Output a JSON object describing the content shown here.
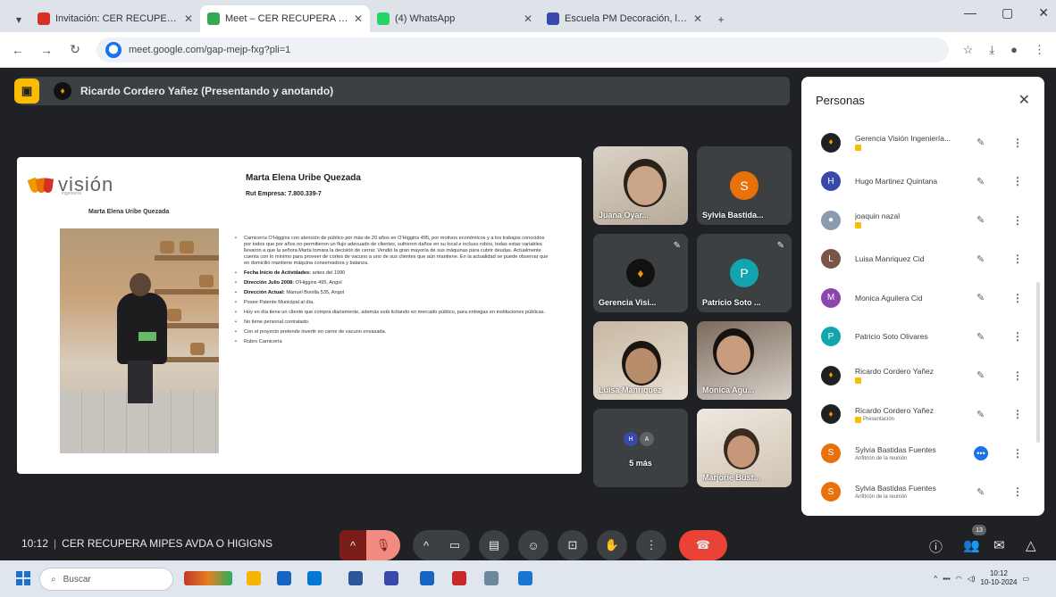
{
  "browser": {
    "tabs": [
      {
        "label": "Invitación: CER RECUPERA MIP...",
        "color": "#d93025",
        "active": false
      },
      {
        "label": "Meet – CER RECUPERA MIP...",
        "color": "#34a853",
        "active": true
      },
      {
        "label": "(4) WhatsApp",
        "color": "#25d366",
        "active": false
      },
      {
        "label": "Escuela PM Decoración, la vent...",
        "color": "#3949ab",
        "active": false
      }
    ],
    "url": "meet.google.com/gap-mejp-fxg?pli=1"
  },
  "meet": {
    "presenter_label": "Ricardo Cordero Yañez (Presentando y anotando)",
    "slide": {
      "logo_text": "visión",
      "logo_sub": "ingeniería",
      "left_caption": "Marta Elena Uribe Quezada",
      "title": "Marta Elena Uribe Quezada",
      "rut": "Rut Empresa: 7.800.339-7",
      "bullets": [
        {
          "bold": "",
          "text": "Carnicería O'Higgins con atención de público por más de 20 años en O'Higgins 495, por motivos económicos y a los trabajos conocidos por todos que por años no permitieron un flujo adecuado de clientes, sufrieron daños en su local e incluso robos, todas estas variables llevaron a que la señora Marta tomara la decisión de cerrar. Vendió la gran mayoría de sus máquinas para cubrir deudas. Actualmente cuenta con lo mínimo para proveer de cortes de vacuno a uno de sus clientes que aún mantiene. En la actualidad se puede observar que en domicilio mantiene máquina conservadora y balanza."
        },
        {
          "bold": "Fecha Inicio de Actividades:",
          "text": " antes del 1990"
        },
        {
          "bold": "Dirección Julio 2008:",
          "text": " O'Higgins 495, Angol"
        },
        {
          "bold": "Dirección Actual:",
          "text": " Manuel Bonilla 535, Angol"
        },
        {
          "bold": "",
          "text": "Posee Patente Municipal al día."
        },
        {
          "bold": "",
          "text": "Hoy en día tiene un cliente que compra diariamente, además está licitando en mercado público, para entregas en instituciones públicas."
        },
        {
          "bold": "",
          "text": "No tiene personal contratado."
        },
        {
          "bold": "",
          "text": "Con el proyecto pretende invertir en carne de vacuno envasada."
        },
        {
          "bold": "",
          "text": "Rubro Carnicería"
        }
      ]
    },
    "tiles": [
      {
        "name": "Juana Oyar...",
        "kind": "video",
        "muted": false
      },
      {
        "name": "Sylvia Bastida...",
        "kind": "avatar",
        "initial": "S",
        "color": "#e8710a",
        "muted": false
      },
      {
        "name": "Gerencia Visi...",
        "kind": "logo",
        "muted": true
      },
      {
        "name": "Patricio Soto ...",
        "kind": "avatar",
        "initial": "P",
        "color": "#12a4af",
        "muted": true
      },
      {
        "name": "Luisa Manriquez",
        "kind": "video",
        "muted": false
      },
      {
        "name": "Monica Agu...",
        "kind": "video",
        "muted": false
      },
      {
        "name": "5 más",
        "kind": "more",
        "muted": false
      },
      {
        "name": "Marjorie Bust...",
        "kind": "video",
        "muted": false
      }
    ],
    "people_panel": {
      "title": "Personas",
      "participants": [
        {
          "name": "Gerencia Visión Ingeniería...",
          "sub": "",
          "badge": true,
          "initial": "",
          "color": "#202124",
          "speaking": false
        },
        {
          "name": "Hugo Martinez Quintana",
          "sub": "",
          "badge": false,
          "initial": "H",
          "color": "#3949ab",
          "speaking": false
        },
        {
          "name": "joaquin nazal",
          "sub": "",
          "badge": true,
          "initial": "",
          "color": "#8a9bb0",
          "speaking": false
        },
        {
          "name": "Luisa Manriquez Cid",
          "sub": "",
          "badge": false,
          "initial": "L",
          "color": "#795548",
          "speaking": false
        },
        {
          "name": "Monica Aguilera Cid",
          "sub": "",
          "badge": false,
          "initial": "M",
          "color": "#8e44ad",
          "speaking": false
        },
        {
          "name": "Patricio Soto Olivares",
          "sub": "",
          "badge": false,
          "initial": "P",
          "color": "#12a4af",
          "speaking": false
        },
        {
          "name": "Ricardo Cordero Yañez",
          "sub": "",
          "badge": true,
          "initial": "",
          "color": "#202124",
          "speaking": false
        },
        {
          "name": "Ricardo Cordero Yañez",
          "sub": "Presentación",
          "badge": true,
          "initial": "",
          "color": "#202124",
          "speaking": false
        },
        {
          "name": "Sylvia Bastidas Fuentes",
          "sub": "Anfitrión de la reunión",
          "badge": false,
          "initial": "S",
          "color": "#e8710a",
          "speaking": true
        },
        {
          "name": "Sylvia Bastidas Fuentes",
          "sub": "Anfitrión de la reunión",
          "badge": false,
          "initial": "S",
          "color": "#e8710a",
          "speaking": false
        }
      ]
    },
    "bottom": {
      "time": "10:12",
      "meeting_name": "CER RECUPERA MIPES AVDA O HIGIGNS",
      "people_count": "13"
    }
  },
  "taskbar": {
    "search_placeholder": "Buscar",
    "time": "10:12",
    "date": "10-10-2024"
  }
}
